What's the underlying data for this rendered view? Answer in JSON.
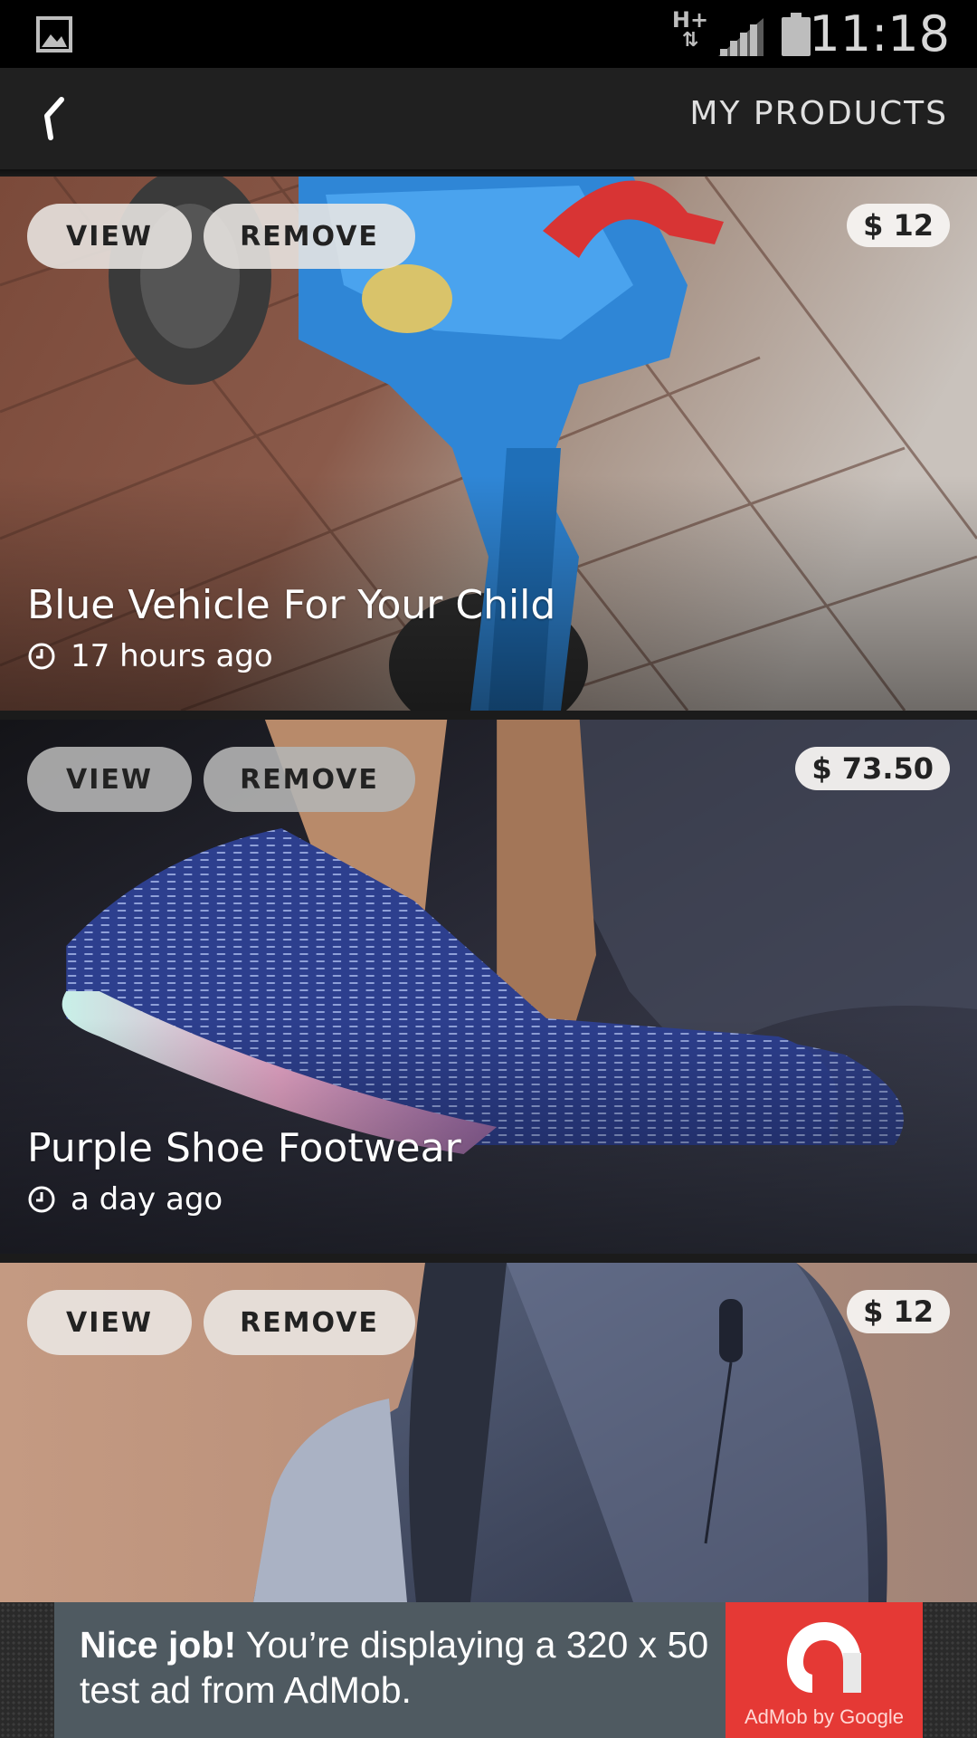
{
  "status_bar": {
    "network": "H+",
    "time": "11:18"
  },
  "app_bar": {
    "title": "MY PRODUCTS"
  },
  "products": [
    {
      "view_label": "VIEW",
      "remove_label": "REMOVE",
      "price": "$ 12",
      "name": "Blue Vehicle For Your Child",
      "posted": "17 hours ago"
    },
    {
      "view_label": "VIEW",
      "remove_label": "REMOVE",
      "price": "$ 73.50",
      "name": "Purple Shoe Footwear",
      "posted": "a day ago"
    },
    {
      "view_label": "VIEW",
      "remove_label": "REMOVE",
      "price": "$ 12"
    }
  ],
  "ad": {
    "headline": "Nice job!",
    "body": "You’re displaying a 320 x 50 test ad from AdMob.",
    "credit": "AdMob by Google"
  }
}
